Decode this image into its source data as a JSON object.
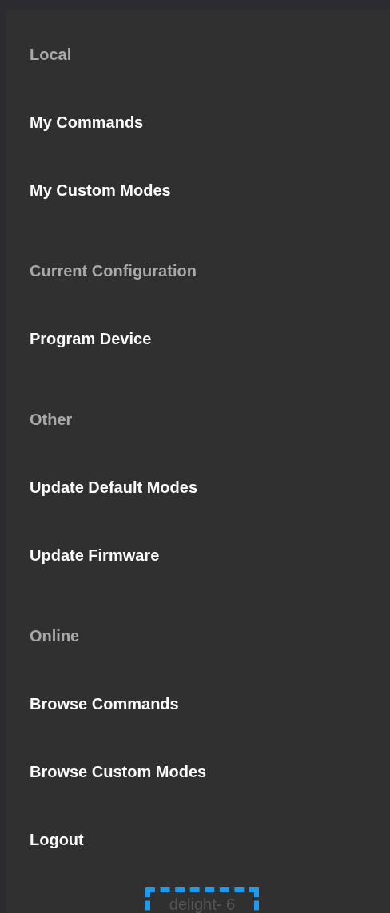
{
  "sections": [
    {
      "header": "Local",
      "items": [
        {
          "label": "My Commands"
        },
        {
          "label": "My Custom Modes"
        }
      ]
    },
    {
      "header": "Current Configuration",
      "items": [
        {
          "label": "Program Device"
        }
      ]
    },
    {
      "header": "Other",
      "items": [
        {
          "label": "Update Default Modes"
        },
        {
          "label": "Update Firmware"
        }
      ]
    },
    {
      "header": "Online",
      "items": [
        {
          "label": "Browse Commands"
        },
        {
          "label": "Browse Custom Modes"
        },
        {
          "label": "Logout"
        }
      ]
    }
  ],
  "footer": {
    "label": "delight- 6",
    "outlined": true
  }
}
